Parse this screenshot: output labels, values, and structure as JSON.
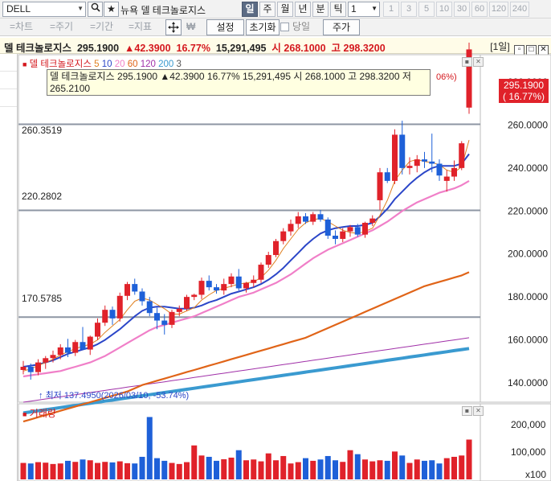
{
  "toolbar": {
    "symbol": "DELL",
    "search_icon": "search-icon",
    "star_icon": "star-icon",
    "exchange": "뉴욕",
    "company": "델 테크놀로지스",
    "periods": [
      "일",
      "주",
      "월",
      "년",
      "분",
      "틱"
    ],
    "active_period": "일",
    "interval_value": "1",
    "interval_presets": [
      "1",
      "3",
      "5",
      "10",
      "30",
      "60",
      "120",
      "240"
    ]
  },
  "toolbar2": {
    "tabs": [
      "=차트",
      "=주기",
      "=기간",
      "=지표"
    ],
    "move_icon": "crosshair-move-icon",
    "won_icon": "won-icon",
    "settings_label": "설정",
    "reset_label": "초기화",
    "today_label": "당일",
    "price_label": "주가"
  },
  "quote": {
    "name": "델 테크놀로지스",
    "price": "295.1900",
    "change": "▲42.3900",
    "change_pct": "16.77%",
    "volume": "15,291,495",
    "open_label": "시",
    "open": "268.1000",
    "high_label": "고",
    "high": "298.3200",
    "view_label": "[1일]",
    "window_icons": [
      "restore-icon",
      "maximize-icon",
      "close-icon"
    ]
  },
  "legend": {
    "title": "델 테크놀로지스",
    "ma_labels": [
      "5",
      "10",
      "20",
      "60",
      "120",
      "200",
      "3"
    ],
    "ma_colors": [
      "#e08020",
      "#2b46c8",
      "#f07fc8",
      "#e06418",
      "#a030a8",
      "#3a9ad0",
      "#555555"
    ]
  },
  "tooltip": {
    "line1": "델 테크놀로지스 295.1900 ▲42.3900 16.77% 15,291,495 시 268.1000 고 298.3200 저",
    "line2": "265.2100",
    "trailing": "06%)"
  },
  "price_box": {
    "price": "295.1900",
    "pct": "( 16.77%)"
  },
  "levels": {
    "l1": "260.3519",
    "l2": "220.2802",
    "l3": "170.5785"
  },
  "yaxis_labels": [
    "280.0000",
    "260.0000",
    "240.0000",
    "220.0000",
    "200.0000",
    "180.0000",
    "160.0000",
    "140.0000"
  ],
  "low_annotation": "최저 137.4950(2026/03/10, -53.74%)",
  "volume": {
    "title": "거래량",
    "axis_labels": [
      "200,000",
      "100,000",
      "x100"
    ]
  },
  "chart_data": {
    "type": "candlestick",
    "y_range": [
      130,
      305
    ],
    "candles": [
      [
        146.0,
        150.2,
        144.0,
        147.5
      ],
      [
        147.5,
        149.0,
        141.5,
        145.0
      ],
      [
        145.0,
        151.0,
        143.5,
        149.5
      ],
      [
        149.5,
        152.5,
        146.5,
        151.5
      ],
      [
        151.5,
        155.0,
        149.5,
        153.0
      ],
      [
        153.0,
        158.0,
        151.0,
        156.5
      ],
      [
        156.5,
        160.5,
        152.0,
        154.0
      ],
      [
        154.0,
        160.0,
        152.5,
        159.0
      ],
      [
        159.0,
        166.0,
        156.0,
        155.5
      ],
      [
        155.5,
        162.0,
        153.0,
        161.5
      ],
      [
        161.5,
        170.0,
        160.0,
        168.0
      ],
      [
        168.0,
        176.0,
        166.5,
        174.0
      ],
      [
        174.0,
        175.5,
        167.0,
        170.0
      ],
      [
        170.0,
        182.0,
        168.5,
        180.5
      ],
      [
        180.5,
        187.0,
        178.5,
        186.0
      ],
      [
        186.0,
        188.5,
        181.0,
        182.5
      ],
      [
        182.5,
        184.0,
        176.0,
        178.0
      ],
      [
        178.0,
        180.0,
        171.0,
        172.5
      ],
      [
        172.5,
        175.0,
        165.0,
        169.0
      ],
      [
        169.0,
        172.0,
        162.5,
        167.0
      ],
      [
        167.0,
        174.0,
        165.5,
        173.0
      ],
      [
        173.0,
        176.0,
        171.0,
        174.5
      ],
      [
        174.5,
        181.0,
        173.5,
        180.0
      ],
      [
        180.0,
        181.5,
        178.5,
        181.0
      ],
      [
        181.0,
        189.0,
        179.0,
        187.5
      ],
      [
        187.5,
        190.0,
        183.0,
        184.5
      ],
      [
        184.5,
        186.0,
        181.5,
        183.0
      ],
      [
        183.0,
        188.5,
        181.0,
        186.0
      ],
      [
        186.0,
        191.0,
        184.5,
        189.5
      ],
      [
        189.5,
        193.0,
        183.0,
        184.0
      ],
      [
        184.0,
        187.0,
        182.0,
        186.5
      ],
      [
        186.5,
        190.0,
        184.5,
        188.0
      ],
      [
        188.0,
        196.0,
        186.5,
        195.0
      ],
      [
        195.0,
        201.0,
        193.5,
        199.5
      ],
      [
        199.5,
        207.0,
        198.5,
        206.0
      ],
      [
        206.0,
        212.0,
        204.5,
        210.5
      ],
      [
        210.5,
        216.0,
        208.5,
        214.0
      ],
      [
        214.0,
        219.5,
        212.0,
        217.5
      ],
      [
        217.5,
        219.0,
        214.0,
        215.0
      ],
      [
        215.0,
        219.5,
        213.5,
        218.5
      ],
      [
        218.5,
        220.5,
        215.0,
        216.0
      ],
      [
        216.0,
        217.0,
        207.0,
        208.5
      ],
      [
        208.5,
        211.0,
        204.5,
        207.0
      ],
      [
        207.0,
        212.0,
        205.5,
        210.5
      ],
      [
        210.5,
        213.5,
        208.0,
        212.5
      ],
      [
        212.5,
        214.0,
        208.0,
        209.0
      ],
      [
        209.0,
        215.0,
        207.5,
        214.5
      ],
      [
        214.5,
        218.0,
        213.0,
        216.5
      ],
      [
        225.0,
        240.0,
        220.5,
        238.0
      ],
      [
        238.0,
        240.0,
        233.0,
        234.0
      ],
      [
        234.0,
        258.0,
        232.5,
        255.5
      ],
      [
        255.5,
        262.0,
        237.0,
        240.0
      ],
      [
        240.0,
        245.0,
        237.0,
        241.0
      ],
      [
        241.0,
        246.0,
        238.0,
        244.0
      ],
      [
        244.0,
        247.5,
        240.0,
        243.0
      ],
      [
        243.0,
        256.0,
        238.0,
        242.0
      ],
      [
        242.0,
        244.0,
        234.0,
        236.5
      ],
      [
        234.0,
        239.0,
        229.0,
        236.0
      ],
      [
        236.0,
        243.5,
        234.0,
        240.0
      ],
      [
        240.0,
        252.5,
        239.0,
        251.5
      ],
      [
        268.1,
        298.32,
        265.21,
        295.19
      ]
    ],
    "ma5": [
      145.5,
      146.5,
      148.0,
      149.5,
      151.0,
      153.0,
      154.5,
      156.0,
      157.0,
      158.0,
      160.0,
      163.5,
      166.5,
      169.5,
      174.0,
      178.0,
      179.5,
      178.5,
      176.5,
      174.5,
      172.0,
      172.0,
      173.5,
      175.0,
      178.5,
      181.0,
      183.0,
      184.0,
      185.0,
      186.0,
      186.5,
      187.0,
      189.0,
      192.5,
      197.0,
      202.5,
      207.0,
      211.5,
      214.5,
      216.0,
      216.5,
      215.0,
      213.0,
      211.0,
      210.0,
      209.5,
      210.5,
      212.0,
      218.0,
      225.0,
      234.0,
      239.0,
      243.0,
      244.0,
      243.0,
      242.5,
      241.5,
      239.0,
      238.0,
      240.5,
      253.0
    ],
    "ma10": [
      147.5,
      148.0,
      148.5,
      149.5,
      150.5,
      152.0,
      153.5,
      154.5,
      155.5,
      156.5,
      158.0,
      160.0,
      162.5,
      165.0,
      168.0,
      171.0,
      173.5,
      175.0,
      175.5,
      175.5,
      175.0,
      174.5,
      174.5,
      175.0,
      176.0,
      177.5,
      178.5,
      180.0,
      181.5,
      182.5,
      183.5,
      184.5,
      186.0,
      188.0,
      190.5,
      193.5,
      197.0,
      200.5,
      204.0,
      207.0,
      209.5,
      211.0,
      212.0,
      212.5,
      213.0,
      213.0,
      213.5,
      214.5,
      217.5,
      221.0,
      225.5,
      229.0,
      232.5,
      235.5,
      238.0,
      240.0,
      241.0,
      241.0,
      241.0,
      242.0,
      246.5
    ],
    "ma20": [
      143.0,
      143.5,
      144.0,
      144.5,
      145.0,
      145.5,
      146.5,
      147.5,
      148.5,
      149.5,
      151.0,
      152.5,
      154.5,
      156.5,
      158.5,
      160.5,
      162.5,
      164.5,
      166.0,
      167.0,
      168.0,
      169.0,
      170.0,
      171.0,
      172.5,
      174.0,
      175.5,
      177.0,
      178.5,
      180.0,
      181.0,
      182.0,
      183.5,
      185.0,
      186.5,
      188.5,
      190.5,
      193.0,
      195.5,
      198.0,
      200.0,
      202.0,
      203.5,
      205.0,
      206.5,
      208.0,
      209.5,
      211.0,
      213.0,
      215.0,
      217.5,
      220.0,
      222.0,
      224.0,
      225.5,
      227.0,
      228.5,
      229.5,
      230.5,
      232.0,
      234.0
    ],
    "ma60": [
      122.0,
      123.0,
      124.0,
      125.0,
      126.0,
      127.0,
      128.0,
      129.0,
      130.0,
      131.0,
      132.0,
      133.0,
      134.0,
      135.0,
      136.0,
      137.5,
      139.0,
      140.0,
      141.0,
      142.0,
      143.0,
      144.0,
      145.0,
      146.0,
      147.0,
      148.0,
      149.0,
      150.0,
      151.0,
      152.0,
      153.0,
      154.0,
      155.0,
      156.0,
      157.0,
      158.0,
      159.0,
      160.0,
      161.0,
      162.5,
      164.0,
      165.5,
      167.0,
      168.5,
      170.0,
      171.5,
      173.0,
      174.5,
      176.0,
      177.5,
      179.0,
      180.5,
      182.0,
      183.5,
      185.0,
      186.0,
      187.0,
      188.0,
      189.0,
      190.0,
      191.5
    ],
    "ma120": [
      131.0,
      131.5,
      132.0,
      132.5,
      133.0,
      133.5,
      134.0,
      134.5,
      135.0,
      135.5,
      136.0,
      136.5,
      137.0,
      137.5,
      138.0,
      138.5,
      139.0,
      139.5,
      140.0,
      140.5,
      141.0,
      141.5,
      142.0,
      142.5,
      143.0,
      143.5,
      144.0,
      144.5,
      145.0,
      145.5,
      146.0,
      146.5,
      147.0,
      147.5,
      148.0,
      148.5,
      149.0,
      149.5,
      150.0,
      150.5,
      151.0,
      151.5,
      152.0,
      152.5,
      153.0,
      153.5,
      154.0,
      154.5,
      155.0,
      155.5,
      156.0,
      156.5,
      157.0,
      157.5,
      158.0,
      158.5,
      159.0,
      159.5,
      160.0,
      160.5,
      161.0
    ],
    "ma200": [
      126.0,
      126.5,
      127.0,
      127.5,
      128.0,
      128.5,
      129.0,
      129.5,
      130.0,
      130.5,
      131.0,
      131.5,
      132.0,
      132.5,
      133.0,
      133.5,
      134.0,
      134.5,
      135.0,
      135.5,
      136.0,
      136.5,
      137.0,
      137.5,
      138.0,
      138.5,
      139.0,
      139.5,
      140.0,
      140.5,
      141.0,
      141.5,
      142.0,
      142.5,
      143.0,
      143.5,
      144.0,
      144.5,
      145.0,
      145.5,
      146.0,
      146.5,
      147.0,
      147.5,
      148.0,
      148.5,
      149.0,
      149.5,
      150.0,
      150.5,
      151.0,
      151.5,
      152.0,
      152.5,
      153.0,
      153.5,
      154.0,
      154.5,
      155.0,
      155.5,
      156.0
    ],
    "volume": [
      62,
      60,
      65,
      63,
      58,
      60,
      70,
      66,
      75,
      72,
      62,
      66,
      64,
      68,
      61,
      60,
      85,
      235,
      80,
      70,
      62,
      58,
      65,
      128,
      90,
      85,
      70,
      76,
      82,
      110,
      72,
      75,
      68,
      98,
      72,
      88,
      60,
      65,
      80,
      70,
      75,
      88,
      72,
      66,
      110,
      95,
      75,
      68,
      72,
      70,
      105,
      90,
      62,
      75,
      70,
      72,
      60,
      80,
      85,
      90,
      150
    ]
  }
}
